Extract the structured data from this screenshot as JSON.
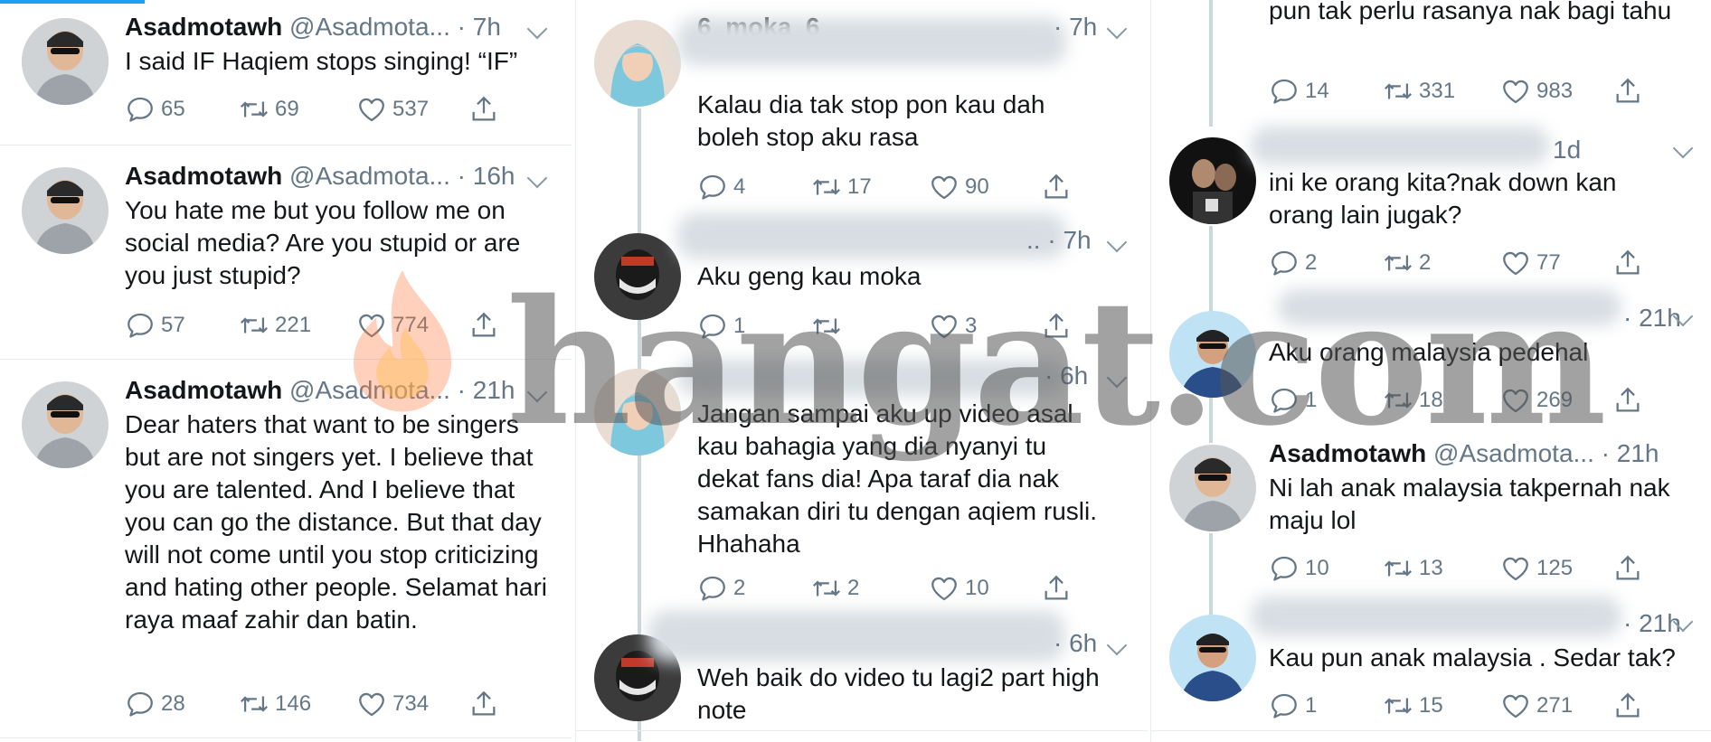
{
  "col1": {
    "tweets": [
      {
        "name": "Asadmotawh",
        "handle": "@Asadmota...",
        "time": "· 7h",
        "text": "I said IF Haqiem stops singing! “IF”",
        "replies": "65",
        "retweets": "69",
        "likes": "537"
      },
      {
        "name": "Asadmotawh",
        "handle": "@Asadmota...",
        "time": "· 16h",
        "text": "You hate me but you follow me on social media? Are you stupid or are you just stupid?",
        "replies": "57",
        "retweets": "221",
        "likes": "774"
      },
      {
        "name": "Asadmotawh",
        "handle": "@Asadmota...",
        "time": "· 21h",
        "text": "Dear haters that want to be singers but are not singers yet. I believe that you are talented. And I believe that you can go the distance. But that day will not come until you stop criticizing and hating other people. Selamat hari raya maaf zahir dan batin.",
        "replies": "28",
        "retweets": "146",
        "likes": "734"
      }
    ]
  },
  "col2": {
    "tweets": [
      {
        "name": "6_moka_6",
        "time": "· 7h",
        "text": "Kalau dia tak stop pon kau dah boleh stop aku rasa",
        "replies": "4",
        "retweets": "17",
        "likes": "90"
      },
      {
        "name": "",
        "time": ".. · 7h",
        "text": "Aku geng kau moka",
        "replies": "1",
        "retweets": "",
        "likes": "3"
      },
      {
        "name": "",
        "time": "· 6h",
        "text": "Jangan sampai aku up video asal kau bahagia yang dia nyanyi tu dekat fans dia! Apa taraf dia nak samakan diri tu dengan aqiem rusli. Hhahaha",
        "replies": "2",
        "retweets": "2",
        "likes": "10"
      },
      {
        "name": "",
        "time": "· 6h",
        "text": "Weh baik do video tu lagi2 part high note",
        "replies": "",
        "retweets": "",
        "likes": ""
      }
    ]
  },
  "col3": {
    "tweets": [
      {
        "name": "",
        "time": "",
        "text": "pun tak perlu rasanya nak bagi tahu",
        "replies": "14",
        "retweets": "331",
        "likes": "983"
      },
      {
        "name": "",
        "time": "1d",
        "text": "ini ke orang kita?nak down kan orang lain jugak?",
        "replies": "2",
        "retweets": "2",
        "likes": "77"
      },
      {
        "name": "",
        "time": "· 21h",
        "text": "Aku orang malaysia pedehal",
        "replies": "1",
        "retweets": "18",
        "likes": "269"
      },
      {
        "name": "Asadmotawh",
        "handle": "@Asadmota...",
        "time": "· 21h",
        "text": "Ni lah anak malaysia takpernah nak maju lol",
        "replies": "10",
        "retweets": "13",
        "likes": "125"
      },
      {
        "name": "",
        "time": "· 21h",
        "text": "Kau pun anak malaysia . Sedar tak?",
        "replies": "1",
        "retweets": "15",
        "likes": "271"
      }
    ]
  },
  "watermark": {
    "text": "hangat.com"
  },
  "icons": [
    "reply-icon",
    "retweet-icon",
    "like-icon",
    "share-icon",
    "chevron-down-icon"
  ],
  "colors": {
    "accent": "#1da1f2",
    "meta": "#657786",
    "icon": "#657786"
  }
}
